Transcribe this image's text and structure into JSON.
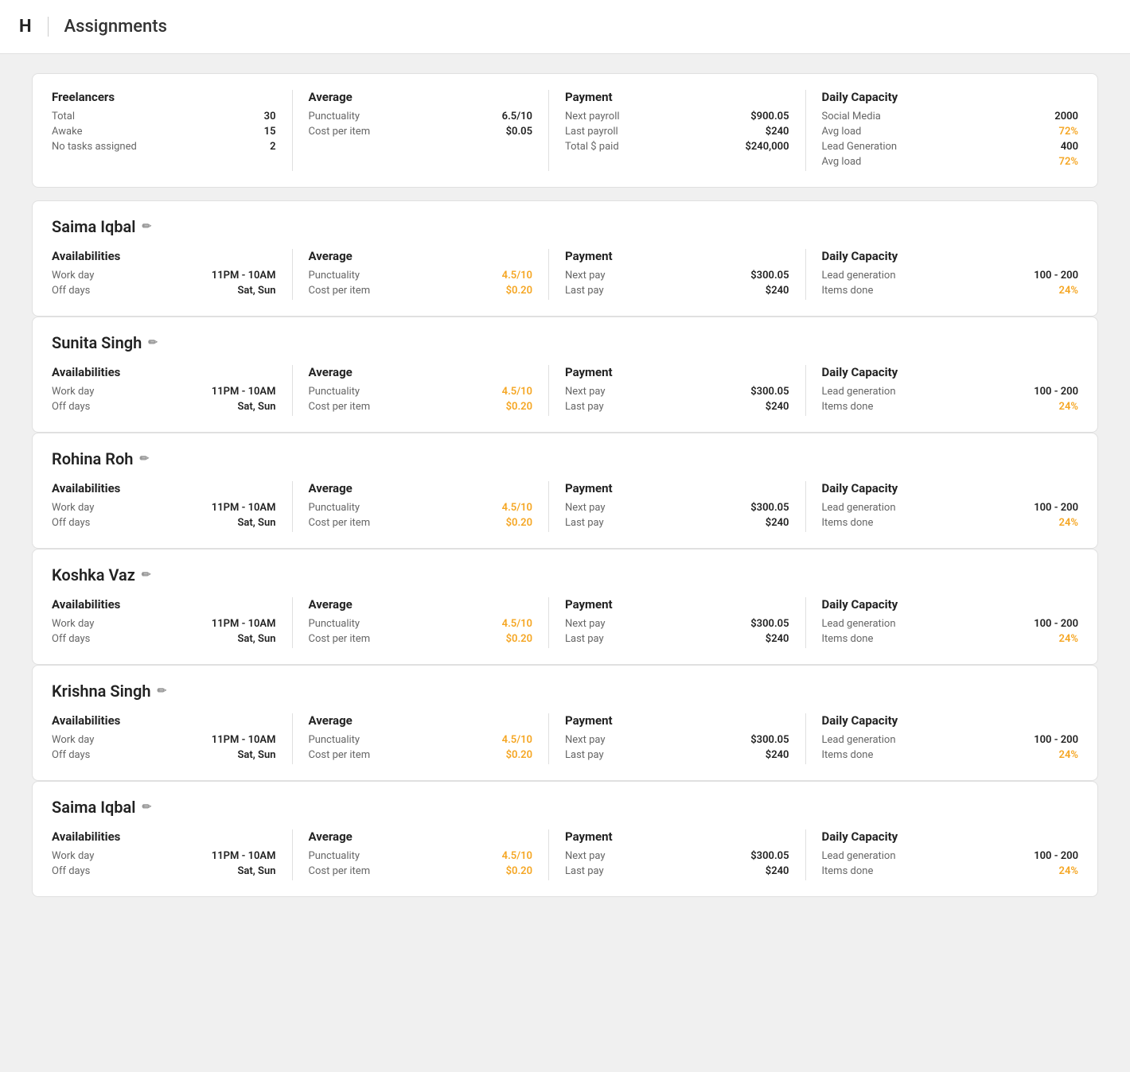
{
  "header": {
    "logo": "H",
    "title": "Assignments"
  },
  "summary": {
    "freelancers": {
      "title": "Freelancers",
      "rows": [
        {
          "label": "Total",
          "value": "30"
        },
        {
          "label": "Awake",
          "value": "15"
        },
        {
          "label": "No tasks assigned",
          "value": "2"
        }
      ]
    },
    "average": {
      "title": "Average",
      "rows": [
        {
          "label": "Punctuality",
          "value": "6.5/10",
          "colored": false
        },
        {
          "label": "Cost per item",
          "value": "$0.05",
          "colored": false
        }
      ]
    },
    "payment": {
      "title": "Payment",
      "rows": [
        {
          "label": "Next payroll",
          "value": "$900.05"
        },
        {
          "label": "Last payroll",
          "value": "$240"
        },
        {
          "label": "Total $ paid",
          "value": "$240,000"
        }
      ]
    },
    "dailyCapacity": {
      "title": "Daily Capacity",
      "rows": [
        {
          "label": "Social Media",
          "value": "2000",
          "colored": false
        },
        {
          "label": "Avg load",
          "value": "72%",
          "colored": true
        },
        {
          "label": "Lead Generation",
          "value": "400",
          "colored": false
        },
        {
          "label": "Avg load",
          "value": "72%",
          "colored": true
        }
      ]
    }
  },
  "freelancers": [
    {
      "name": "Saima Iqbal",
      "availabilities": {
        "title": "Availabilities",
        "rows": [
          {
            "label": "Work day",
            "value": "11PM - 10AM"
          },
          {
            "label": "Off days",
            "value": "Sat, Sun"
          }
        ]
      },
      "average": {
        "title": "Average",
        "rows": [
          {
            "label": "Punctuality",
            "value": "4.5/10",
            "colored": true
          },
          {
            "label": "Cost per item",
            "value": "$0.20",
            "colored": true
          }
        ]
      },
      "payment": {
        "title": "Payment",
        "rows": [
          {
            "label": "Next pay",
            "value": "$300.05"
          },
          {
            "label": "Last pay",
            "value": "$240"
          }
        ]
      },
      "dailyCapacity": {
        "title": "Daily Capacity",
        "rows": [
          {
            "label": "Lead generation",
            "value": "100 - 200",
            "colored": false
          },
          {
            "label": "Items done",
            "value": "24%",
            "colored": true
          }
        ]
      }
    },
    {
      "name": "Sunita Singh",
      "availabilities": {
        "title": "Availabilities",
        "rows": [
          {
            "label": "Work day",
            "value": "11PM - 10AM"
          },
          {
            "label": "Off days",
            "value": "Sat, Sun"
          }
        ]
      },
      "average": {
        "title": "Average",
        "rows": [
          {
            "label": "Punctuality",
            "value": "4.5/10",
            "colored": true
          },
          {
            "label": "Cost per item",
            "value": "$0.20",
            "colored": true
          }
        ]
      },
      "payment": {
        "title": "Payment",
        "rows": [
          {
            "label": "Next pay",
            "value": "$300.05"
          },
          {
            "label": "Last pay",
            "value": "$240"
          }
        ]
      },
      "dailyCapacity": {
        "title": "Daily Capacity",
        "rows": [
          {
            "label": "Lead generation",
            "value": "100 - 200",
            "colored": false
          },
          {
            "label": "Items done",
            "value": "24%",
            "colored": true
          }
        ]
      }
    },
    {
      "name": "Rohina Roh",
      "availabilities": {
        "title": "Availabilities",
        "rows": [
          {
            "label": "Work day",
            "value": "11PM - 10AM"
          },
          {
            "label": "Off days",
            "value": "Sat, Sun"
          }
        ]
      },
      "average": {
        "title": "Average",
        "rows": [
          {
            "label": "Punctuality",
            "value": "4.5/10",
            "colored": true
          },
          {
            "label": "Cost per item",
            "value": "$0.20",
            "colored": true
          }
        ]
      },
      "payment": {
        "title": "Payment",
        "rows": [
          {
            "label": "Next pay",
            "value": "$300.05"
          },
          {
            "label": "Last pay",
            "value": "$240"
          }
        ]
      },
      "dailyCapacity": {
        "title": "Daily Capacity",
        "rows": [
          {
            "label": "Lead generation",
            "value": "100 - 200",
            "colored": false
          },
          {
            "label": "Items done",
            "value": "24%",
            "colored": true
          }
        ]
      }
    },
    {
      "name": "Koshka Vaz",
      "availabilities": {
        "title": "Availabilities",
        "rows": [
          {
            "label": "Work day",
            "value": "11PM - 10AM"
          },
          {
            "label": "Off days",
            "value": "Sat, Sun"
          }
        ]
      },
      "average": {
        "title": "Average",
        "rows": [
          {
            "label": "Punctuality",
            "value": "4.5/10",
            "colored": true
          },
          {
            "label": "Cost per item",
            "value": "$0.20",
            "colored": true
          }
        ]
      },
      "payment": {
        "title": "Payment",
        "rows": [
          {
            "label": "Next pay",
            "value": "$300.05"
          },
          {
            "label": "Last pay",
            "value": "$240"
          }
        ]
      },
      "dailyCapacity": {
        "title": "Daily Capacity",
        "rows": [
          {
            "label": "Lead generation",
            "value": "100 - 200",
            "colored": false
          },
          {
            "label": "Items done",
            "value": "24%",
            "colored": true
          }
        ]
      }
    },
    {
      "name": "Krishna Singh",
      "availabilities": {
        "title": "Availabilities",
        "rows": [
          {
            "label": "Work day",
            "value": "11PM - 10AM"
          },
          {
            "label": "Off days",
            "value": "Sat, Sun"
          }
        ]
      },
      "average": {
        "title": "Average",
        "rows": [
          {
            "label": "Punctuality",
            "value": "4.5/10",
            "colored": true
          },
          {
            "label": "Cost per item",
            "value": "$0.20",
            "colored": true
          }
        ]
      },
      "payment": {
        "title": "Payment",
        "rows": [
          {
            "label": "Next pay",
            "value": "$300.05"
          },
          {
            "label": "Last pay",
            "value": "$240"
          }
        ]
      },
      "dailyCapacity": {
        "title": "Daily Capacity",
        "rows": [
          {
            "label": "Lead generation",
            "value": "100 - 200",
            "colored": false
          },
          {
            "label": "Items done",
            "value": "24%",
            "colored": true
          }
        ]
      }
    },
    {
      "name": "Saima Iqbal",
      "availabilities": {
        "title": "Availabilities",
        "rows": [
          {
            "label": "Work day",
            "value": "11PM - 10AM"
          },
          {
            "label": "Off days",
            "value": "Sat, Sun"
          }
        ]
      },
      "average": {
        "title": "Average",
        "rows": [
          {
            "label": "Punctuality",
            "value": "4.5/10",
            "colored": true
          },
          {
            "label": "Cost per item",
            "value": "$0.20",
            "colored": true
          }
        ]
      },
      "payment": {
        "title": "Payment",
        "rows": [
          {
            "label": "Next pay",
            "value": "$300.05"
          },
          {
            "label": "Last pay",
            "value": "$240"
          }
        ]
      },
      "dailyCapacity": {
        "title": "Daily Capacity",
        "rows": [
          {
            "label": "Lead generation",
            "value": "100 - 200",
            "colored": false
          },
          {
            "label": "Items done",
            "value": "24%",
            "colored": true
          }
        ]
      }
    }
  ],
  "icons": {
    "edit": "✏"
  }
}
